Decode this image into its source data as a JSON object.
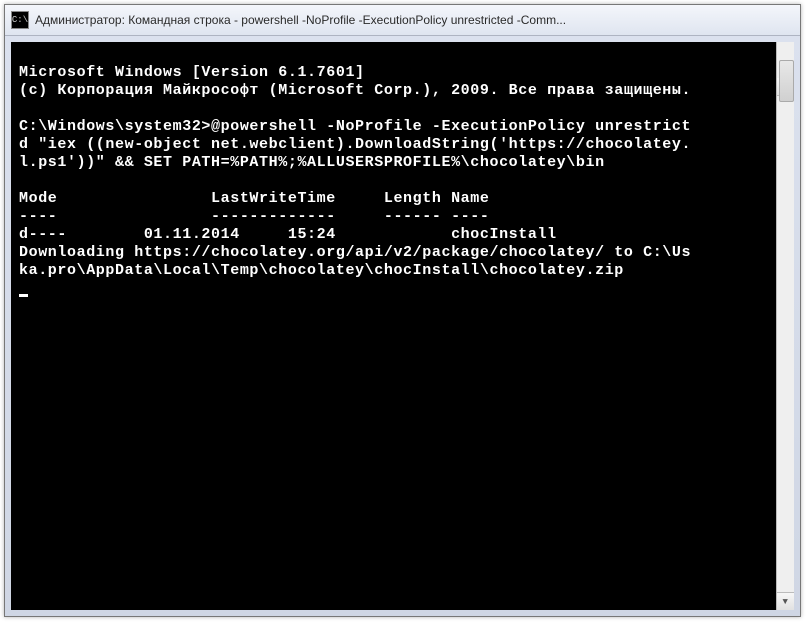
{
  "window": {
    "icon_text": "C:\\",
    "title": "Администратор: Командная строка - powershell  -NoProfile -ExecutionPolicy unrestricted -Comm..."
  },
  "terminal": {
    "lines": [
      "Microsoft Windows [Version 6.1.7601]",
      "(c) Корпорация Майкрософт (Microsoft Corp.), 2009. Все права защищены.",
      "",
      "C:\\Windows\\system32>@powershell -NoProfile -ExecutionPolicy unrestrict",
      "d \"iex ((new-object net.webclient).DownloadString('https://chocolatey.",
      "l.ps1'))\" && SET PATH=%PATH%;%ALLUSERSPROFILE%\\chocolatey\\bin",
      "",
      "Mode                LastWriteTime     Length Name",
      "----                -------------     ------ ----",
      "d----        01.11.2014     15:24            chocInstall",
      "Downloading https://chocolatey.org/api/v2/package/chocolatey/ to C:\\Us",
      "ka.pro\\AppData\\Local\\Temp\\chocolatey\\chocInstall\\chocolatey.zip"
    ]
  }
}
